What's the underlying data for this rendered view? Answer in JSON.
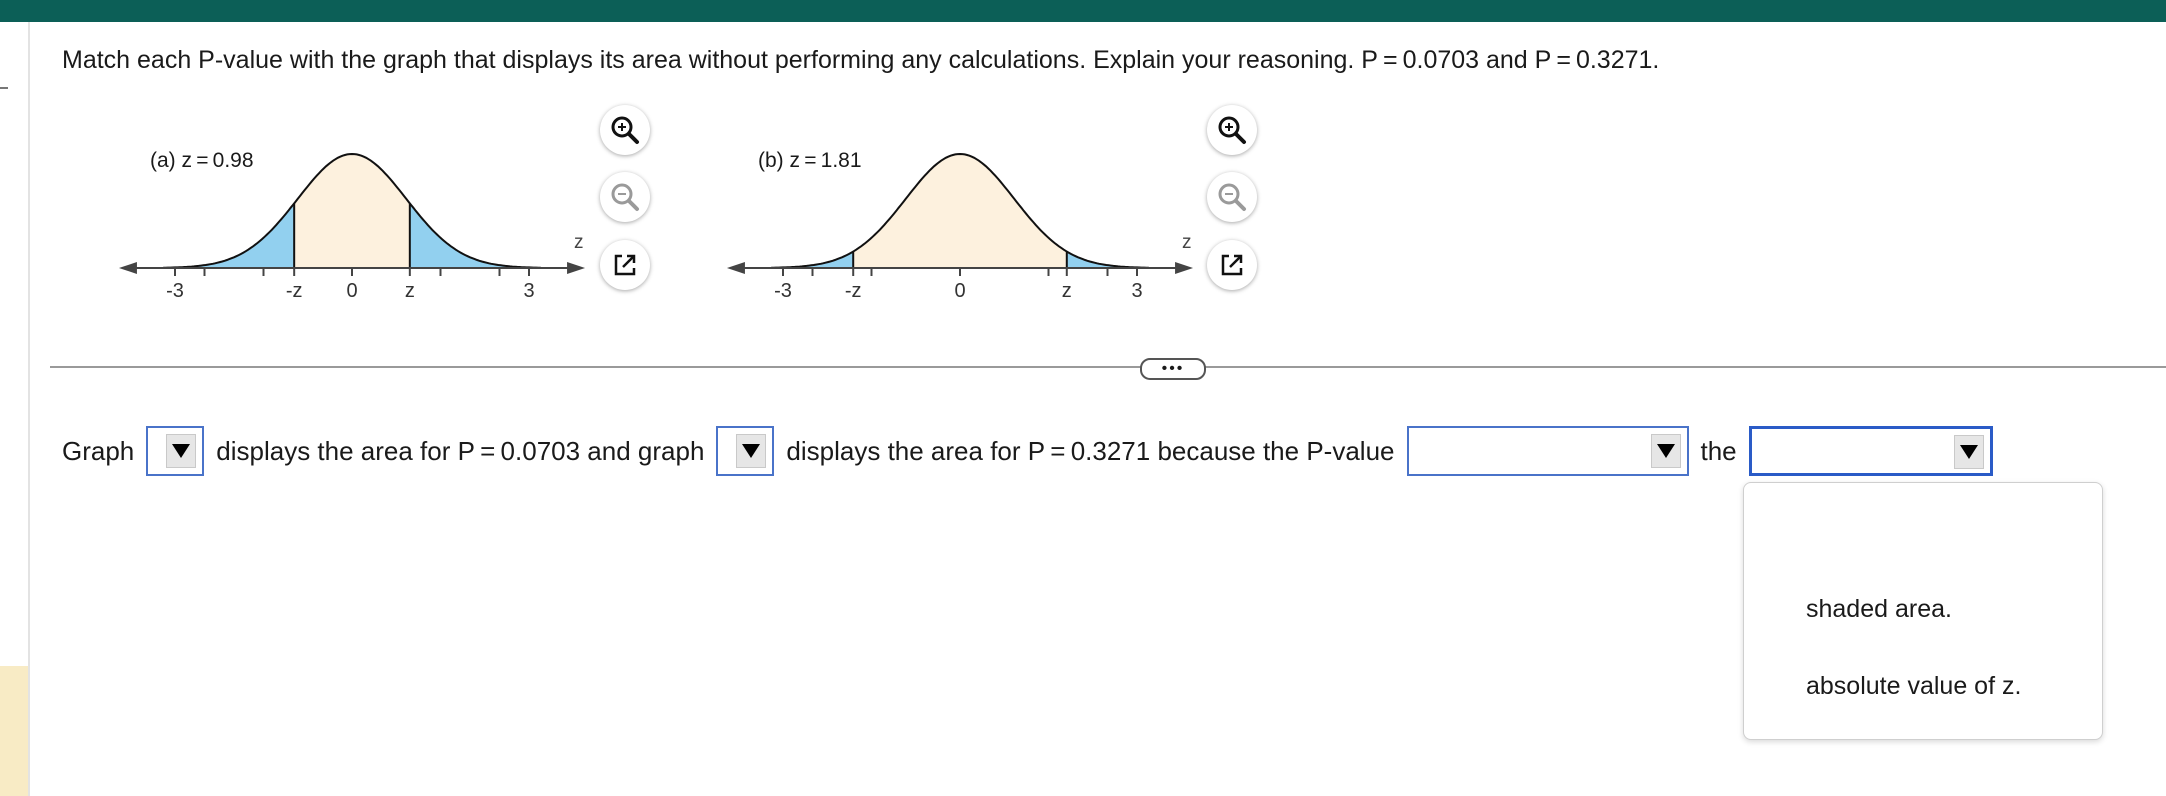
{
  "question": "Match each P-value with the graph that displays its area without performing any calculations. Explain your reasoning. P = 0.0703 and P = 0.3271.",
  "graphs": [
    {
      "label": "(a) z = 0.98",
      "z_value": 0.98,
      "axis_name": "z",
      "ticks": [
        {
          "label": "-3",
          "x": -3
        },
        {
          "label": "-z",
          "x": -0.98
        },
        {
          "label": "0",
          "x": 0
        },
        {
          "label": "z",
          "x": 0.98
        },
        {
          "label": "3",
          "x": 3
        }
      ],
      "tail_color": "#92d0ef",
      "center_color": "#fdf1de"
    },
    {
      "label": "(b) z = 1.81",
      "z_value": 1.81,
      "axis_name": "z",
      "ticks": [
        {
          "label": "-3",
          "x": -3
        },
        {
          "label": "-z",
          "x": -1.81
        },
        {
          "label": "0",
          "x": 0
        },
        {
          "label": "z",
          "x": 1.81
        },
        {
          "label": "3",
          "x": 3
        }
      ],
      "tail_color": "#92d0ef",
      "center_color": "#fdf1de"
    }
  ],
  "toolbar_icons": [
    "zoom-in-icon",
    "zoom-out-icon",
    "open-external-icon"
  ],
  "answer": {
    "word_graph": "Graph",
    "text_1": "displays the area for P = 0.0703 and graph",
    "text_2": "displays the area for P = 0.3271 because the P-value",
    "word_the": "the",
    "dropdown_1_value": "",
    "dropdown_2_value": "",
    "dropdown_3_value": "",
    "dropdown_4_value": ""
  },
  "more_button_label": "•••",
  "menu_options": [
    "shaded area.",
    "absolute value of z."
  ],
  "colors": {
    "header": "#0c5f57",
    "dropdown_border": "#4a73c9",
    "side_panel": "#f8ebc5"
  }
}
